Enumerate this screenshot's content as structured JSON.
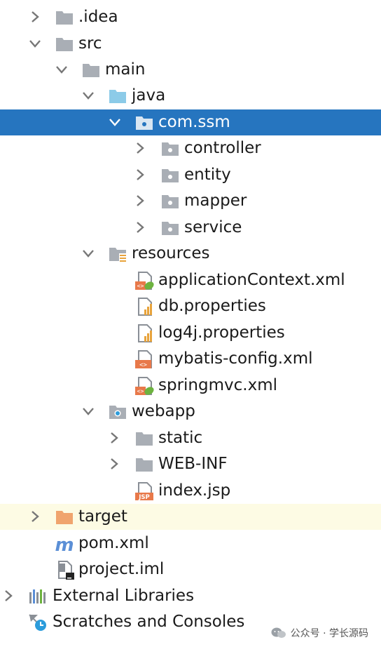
{
  "tree": {
    "nodes": [
      {
        "label": ".idea",
        "icon": "folder-icon"
      },
      {
        "label": "src",
        "icon": "folder-icon"
      },
      {
        "label": "main",
        "icon": "folder-icon"
      },
      {
        "label": "java",
        "icon": "source-folder-icon"
      },
      {
        "label": "com.ssm",
        "icon": "package-icon"
      },
      {
        "label": "controller",
        "icon": "package-icon"
      },
      {
        "label": "entity",
        "icon": "package-icon"
      },
      {
        "label": "mapper",
        "icon": "package-icon"
      },
      {
        "label": "service",
        "icon": "package-icon"
      },
      {
        "label": "resources",
        "icon": "resources-folder-icon"
      },
      {
        "label": "applicationContext.xml",
        "icon": "spring-xml-icon"
      },
      {
        "label": "db.properties",
        "icon": "properties-file-icon"
      },
      {
        "label": "log4j.properties",
        "icon": "properties-file-icon"
      },
      {
        "label": "mybatis-config.xml",
        "icon": "xml-file-icon"
      },
      {
        "label": "springmvc.xml",
        "icon": "spring-xml-icon"
      },
      {
        "label": "webapp",
        "icon": "web-folder-icon"
      },
      {
        "label": "static",
        "icon": "folder-icon"
      },
      {
        "label": "WEB-INF",
        "icon": "folder-icon"
      },
      {
        "label": "index.jsp",
        "icon": "jsp-file-icon"
      },
      {
        "label": "target",
        "icon": "excluded-folder-icon"
      },
      {
        "label": "pom.xml",
        "icon": "maven-icon"
      },
      {
        "label": "project.iml",
        "icon": "iml-file-icon"
      },
      {
        "label": "External Libraries",
        "icon": "libraries-icon"
      },
      {
        "label": "Scratches and Consoles",
        "icon": "scratches-icon"
      }
    ]
  },
  "badges": {
    "jsp": "JSP"
  },
  "watermark": {
    "text": "公众号 · 学长源码"
  },
  "colors": {
    "selection": "#2675BF",
    "highlight": "#FDFBE4",
    "folder": "#A9AEB5",
    "source_folder": "#8CCBE8",
    "excluded_folder": "#F0A46E",
    "xml_badge": "#E8794A",
    "spring_leaf": "#6DB33F"
  }
}
